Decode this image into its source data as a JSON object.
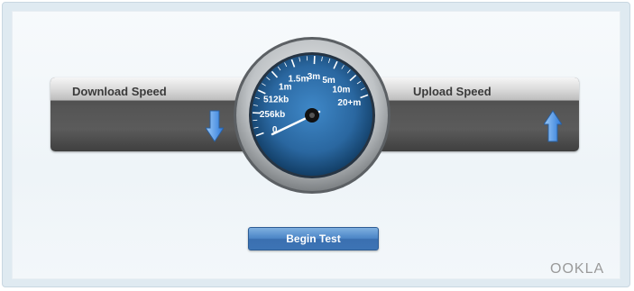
{
  "download": {
    "label": "Download Speed",
    "value": "",
    "arrow_icon": "arrow-down-icon"
  },
  "upload": {
    "label": "Upload Speed",
    "value": "",
    "arrow_icon": "arrow-up-icon"
  },
  "gauge": {
    "scale_labels": [
      "0",
      "256kb",
      "512kb",
      "1m",
      "1.5m",
      "3m",
      "5m",
      "10m",
      "20+m"
    ],
    "needle_value": "0"
  },
  "begin_button": {
    "label": "Begin Test"
  },
  "brand": {
    "logo_text": "OOKLA"
  },
  "colors": {
    "panel": "#4a4a4a",
    "gauge_blue": "#2f6fa8",
    "button_blue": "#4b85c6",
    "arrow_blue": "#3b86e0"
  }
}
